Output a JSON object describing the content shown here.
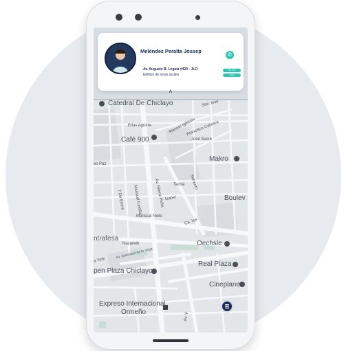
{
  "driver": {
    "name": "Meléndez Peralta Jossep",
    "address": "Av. Augusto B. Leguía #420 - JLO",
    "building": "Edificio de lunas azules",
    "badges": [
      "En ruta",
      "0 km"
    ]
  },
  "icons": {
    "call": "phone-icon",
    "expand": "chevron-up-icon",
    "menu": "list-icon"
  },
  "map": {
    "labels": {
      "cathedral": "Catedral De Chiclayo",
      "san_jose": "San José",
      "elias_aguirre": "Elías Aguirre",
      "manuel_iglesias": "Manuel Iglesias",
      "francisco_cabrera": "Francisco Cabrera",
      "cafe_900": "Café 900",
      "jose_sucre": "José Sucre",
      "makro": "Makro",
      "paz": "es Paz",
      "mariscal_castilla": "Mariscal Castilla",
      "siete_enero": "7 De Enero",
      "saenz_pena": "Av. Sáenz Peña",
      "tacna": "Tacna",
      "izabel": "Izabel",
      "sorrento": "Sorrento",
      "boulevard": "Boulev",
      "mariscal_nieto": "Mariscal Nieto",
      "ca_ica": "Ca. Ica",
      "trafesa": "ntrafesa",
      "nazareth": "Nazareth",
      "garcilaso": "Av. Garcilaso de la Vega",
      "york": "a York",
      "oechsle": "Oechsle",
      "real_plaza": "Real Plaza",
      "open_plaza": "pen Plaza Chiclayo",
      "cineplanet": "Cineplanet",
      "expreso": "Expreso Internacional",
      "ormeno": "Ormeño",
      "av_v": "Av. V"
    }
  }
}
